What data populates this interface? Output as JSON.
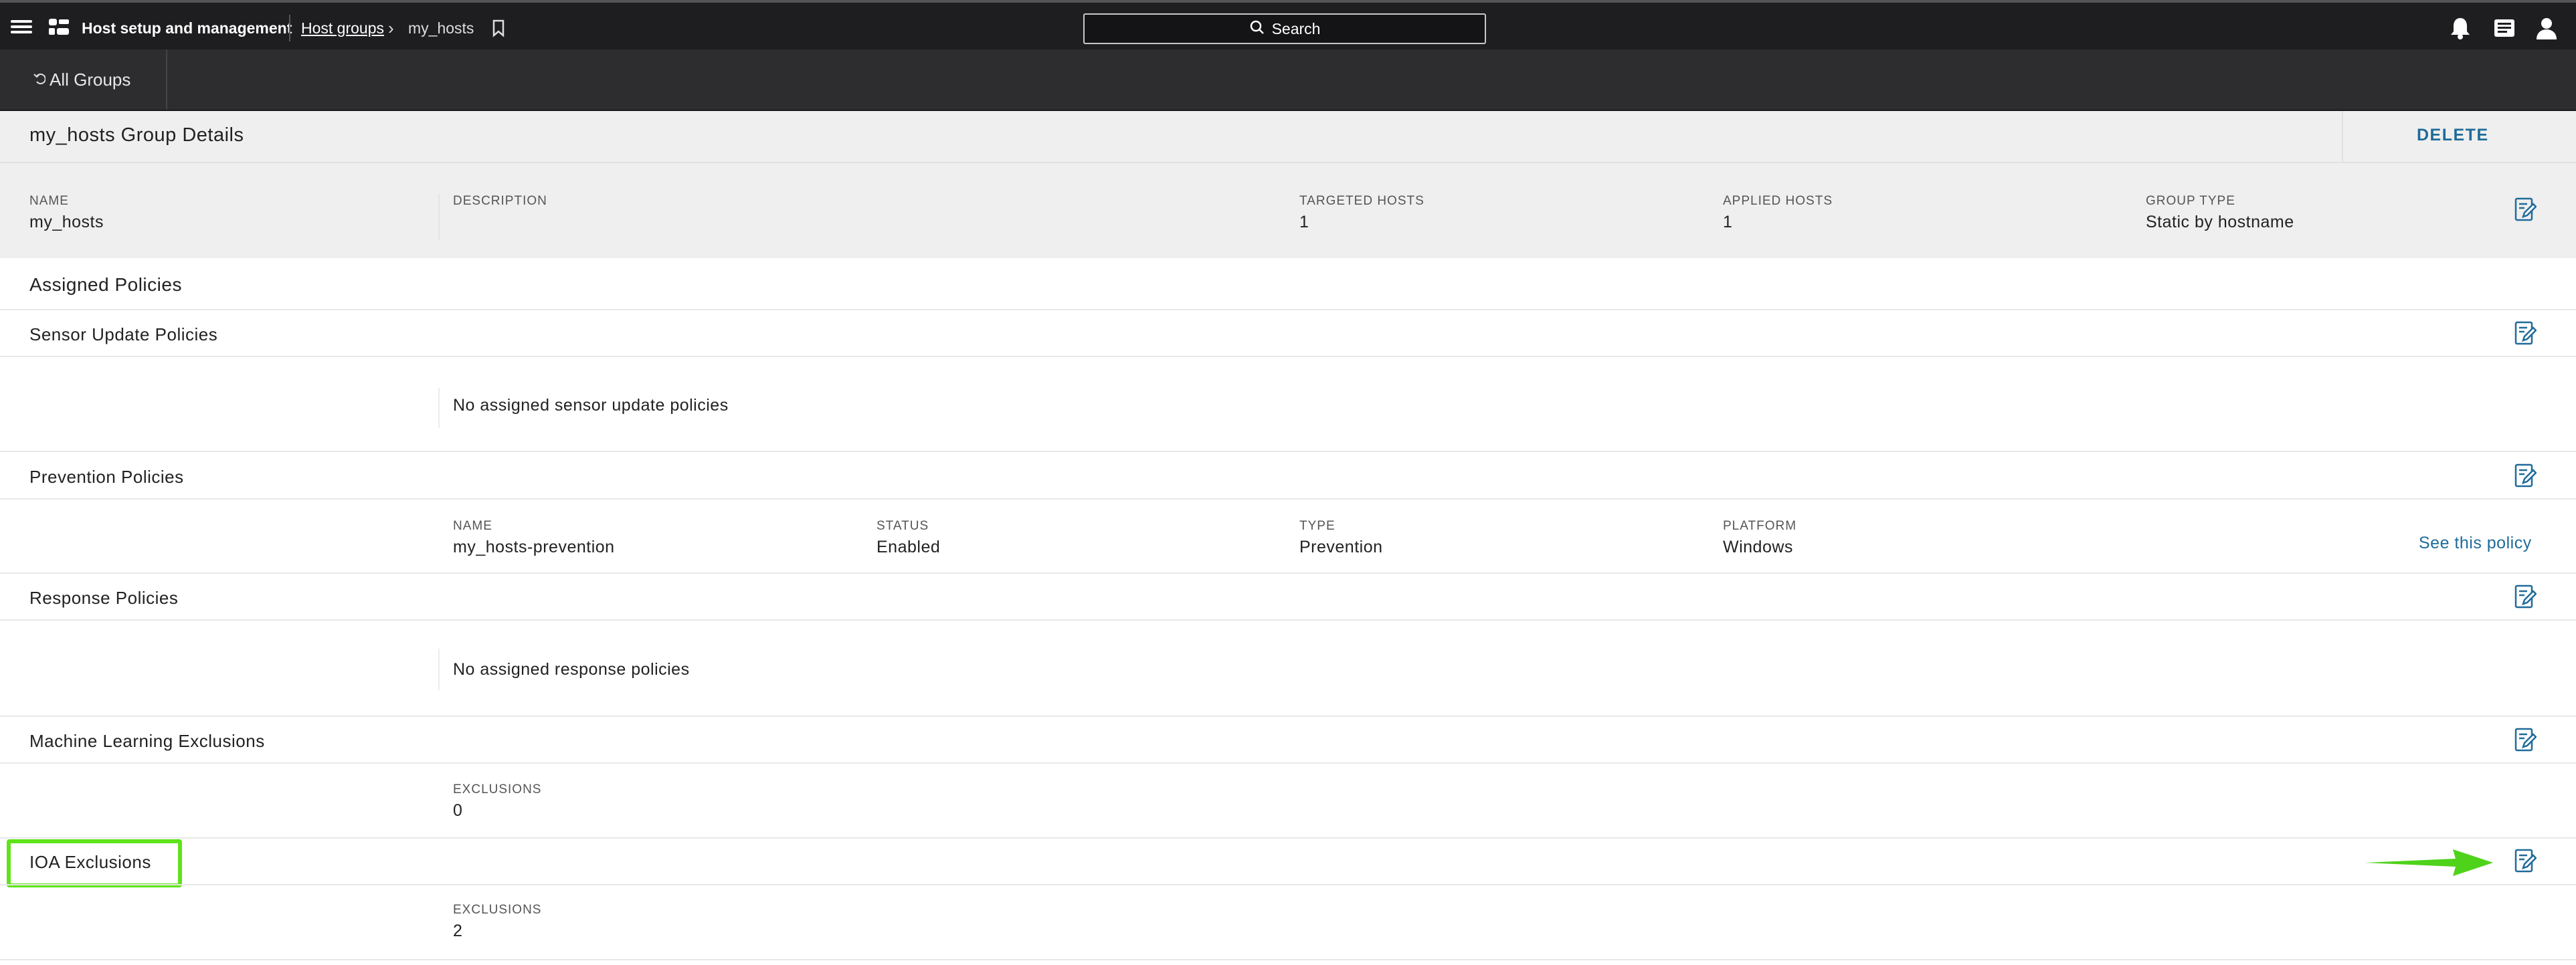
{
  "topbar": {
    "app_title": "Host setup and management",
    "breadcrumb_link": "Host groups",
    "breadcrumb_separator": "›",
    "breadcrumb_current": "my_hosts",
    "search_label": "Search",
    "icons": [
      "menu-icon",
      "app-grid-icon",
      "bookmark-icon",
      "search-icon",
      "bell-icon",
      "feed-icon",
      "user-icon"
    ]
  },
  "subbar": {
    "back_label": "All Groups"
  },
  "group": {
    "title": "my_hosts Group Details",
    "delete_label": "DELETE",
    "fields": [
      {
        "key": "NAME",
        "value": "my_hosts"
      },
      {
        "key": "DESCRIPTION",
        "value": ""
      },
      {
        "key": "TARGETED HOSTS",
        "value": "1"
      },
      {
        "key": "APPLIED HOSTS",
        "value": "1"
      },
      {
        "key": "GROUP TYPE",
        "value": "Static by hostname"
      }
    ]
  },
  "assigned": {
    "title": "Assigned Policies",
    "sensor_update": {
      "title": "Sensor Update Policies",
      "empty_message": "No assigned sensor update policies"
    },
    "prevention": {
      "title": "Prevention Policies",
      "columns": [
        {
          "key": "NAME",
          "value": "my_hosts-prevention"
        },
        {
          "key": "STATUS",
          "value": "Enabled"
        },
        {
          "key": "TYPE",
          "value": "Prevention"
        },
        {
          "key": "PLATFORM",
          "value": "Windows"
        }
      ],
      "link_label": "See this policy"
    },
    "response": {
      "title": "Response Policies",
      "empty_message": "No assigned response policies"
    },
    "ml_exclusions": {
      "title": "Machine Learning Exclusions",
      "key": "EXCLUSIONS",
      "value": "0"
    },
    "ioa_exclusions": {
      "title": "IOA Exclusions",
      "key": "EXCLUSIONS",
      "value": "2"
    }
  },
  "colors": {
    "topbar_bg": "#1e1e21",
    "subbar_bg": "#2d2d30",
    "header_bg": "#efefef",
    "accent_link": "#1f6b9a",
    "highlight": "#5fe31a"
  }
}
